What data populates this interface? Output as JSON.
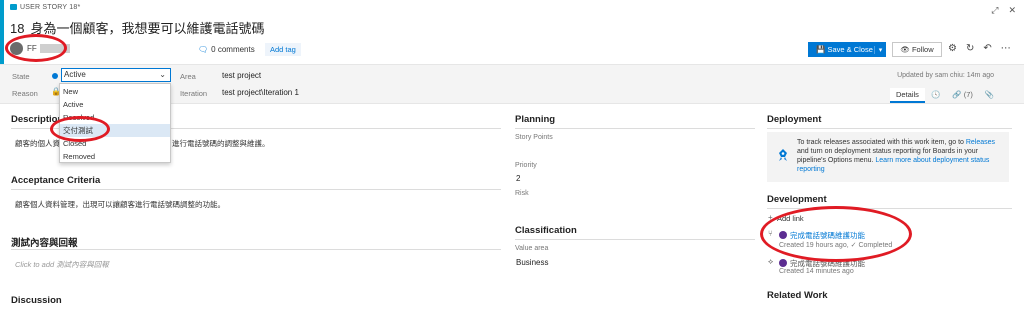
{
  "header": {
    "work_item_type": "USER STORY 18*",
    "id": "18",
    "title": "身為一個顧客，我想要可以維護電話號碼",
    "assignee": "FF",
    "comments": "0 comments",
    "add_tag": "Add tag",
    "save_close": "Save & Close",
    "follow": "Follow"
  },
  "fields": {
    "state_label": "State",
    "state_value": "Active",
    "reason_label": "Reason",
    "area_label": "Area",
    "area_value": "test project",
    "iteration_label": "Iteration",
    "iteration_value": "test project\\Iteration 1",
    "updated": "Updated by sam chiu: 14m ago"
  },
  "state_options": [
    "New",
    "Active",
    "Resolved",
    "交付測試",
    "Closed",
    "Removed"
  ],
  "tabs": {
    "details": "Details",
    "links_count": "(7)"
  },
  "description": {
    "title": "Description",
    "text_left": "顧客的個人資",
    "text_right": "進行電話號碼的調整與維護。"
  },
  "acceptance": {
    "title": "Acceptance Criteria",
    "text": "顧客個人資料管理，出現可以讓顧客進行電話號碼調整的功能。"
  },
  "test_content": {
    "title": "測試內容與回報",
    "placeholder": "Click to add 測試內容與回報"
  },
  "discussion": {
    "title": "Discussion"
  },
  "planning": {
    "title": "Planning",
    "story_points_label": "Story Points",
    "priority_label": "Priority",
    "priority_value": "2",
    "risk_label": "Risk"
  },
  "classification": {
    "title": "Classification",
    "value_area_label": "Value area",
    "value_area_value": "Business"
  },
  "deployment": {
    "title": "Deployment",
    "text_1": "To track releases associated with this work item, go to ",
    "link_releases": "Releases",
    "text_2": " and turn on deployment status reporting for Boards in your pipeline's Options menu. ",
    "link_learn": "Learn more about deployment status reporting"
  },
  "development": {
    "title": "Development",
    "add_link": "Add link",
    "pr_title": "完成電話號碼維護功能",
    "pr_meta": "Created 19 hours ago,",
    "pr_status": "Completed",
    "commit_title": "完成電話號碼維護功能",
    "commit_meta": "Created 14 minutes ago"
  },
  "related_work": {
    "title": "Related Work"
  },
  "colors": {
    "accent": "#0078d4",
    "story_blue": "#009ccc",
    "annotation_red": "#e01b24"
  }
}
